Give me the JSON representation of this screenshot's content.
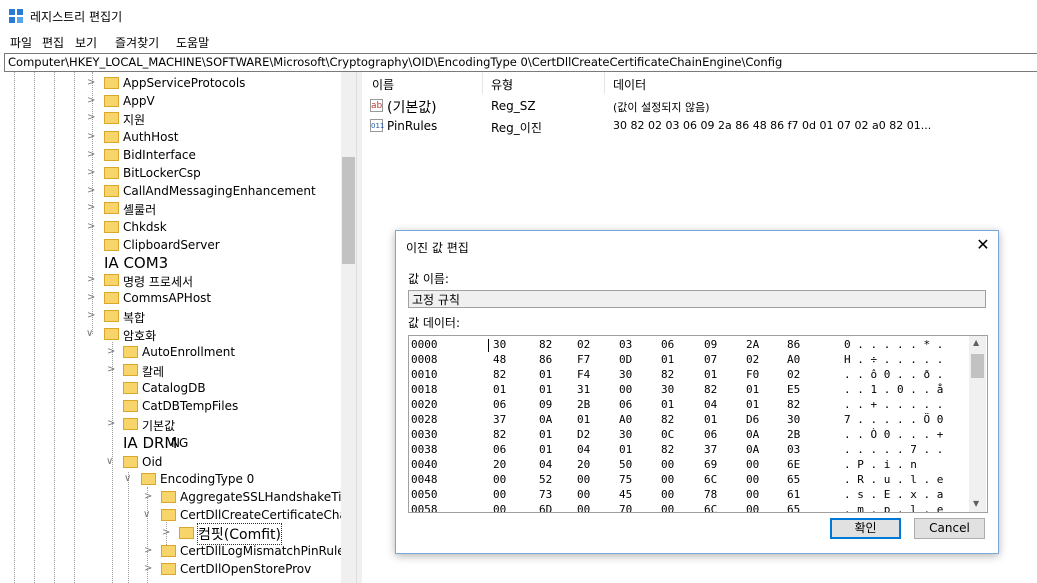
{
  "window": {
    "title": "레지스트리 편집기"
  },
  "menu": [
    "파일",
    "편집",
    "보기",
    "즐겨찾기",
    "도움말"
  ],
  "address": "Computer\\HKEY_LOCAL_MACHINE\\SOFTWARE\\Microsoft\\Cryptography\\OID\\EncodingType 0\\CertDllCreateCertificateChainEngine\\Config",
  "tree": {
    "items": [
      {
        "label": "AppServiceProtocols"
      },
      {
        "label": "AppV"
      },
      {
        "label": "지원"
      },
      {
        "label": "AuthHost"
      },
      {
        "label": "BidInterface"
      },
      {
        "label": "BitLockerCsp"
      },
      {
        "label": "CallAndMessagingEnhancement"
      },
      {
        "label": "셸룰러"
      },
      {
        "label": "Chkdsk"
      },
      {
        "label": "ClipboardServer"
      },
      {
        "label": "IA COM3"
      },
      {
        "label": "명령 프로세서"
      },
      {
        "label": "CommsAPHost"
      },
      {
        "label": "복합"
      },
      {
        "label": "암호화"
      },
      {
        "label": "AutoEnrollment"
      },
      {
        "label": "칼레"
      },
      {
        "label": "CatalogDB"
      },
      {
        "label": "CatDBTempFiles"
      },
      {
        "label": "기본값"
      },
      {
        "label": "IA DRM"
      },
      {
        "label": "Oid"
      },
      {
        "label": "EncodingType 0"
      },
      {
        "label": "AggregateSSLHandshakeTime"
      },
      {
        "label": "CertDllCreateCertificateChainE"
      },
      {
        "label": "컴핏(Comfit)"
      },
      {
        "label": "CertDllLogMismatchPinRules"
      },
      {
        "label": "CertDllOpenStoreProv"
      }
    ],
    "overlap_label": "NG"
  },
  "list": {
    "columns": [
      "이름",
      "유형",
      "데이터"
    ],
    "rows": [
      {
        "icon": "ab",
        "name": "(기본값)",
        "type": "Reg_SZ",
        "data": "(값이 설정되지 않음)"
      },
      {
        "icon": "011",
        "name": "PinRules",
        "type": "Reg_이진",
        "data": "30 82 02 03 06 09 2a 86 48 86 f7 0d 01 07 02 a0 82 01..."
      }
    ]
  },
  "dialog": {
    "title": "이진 값 편집",
    "name_label": "값 이름:",
    "name_value": "고정 규칙",
    "data_label": "값 데이터:",
    "hex_rows": [
      {
        "addr": "0000",
        "bytes": [
          "30",
          "82",
          "02",
          "03",
          "06",
          "09",
          "2A",
          "86"
        ],
        "ascii": "0 . . . . . * ."
      },
      {
        "addr": "0008",
        "bytes": [
          "48",
          "86",
          "F7",
          "0D",
          "01",
          "07",
          "02",
          "A0"
        ],
        "ascii": "H . ÷ . . . . ."
      },
      {
        "addr": "0010",
        "bytes": [
          "82",
          "01",
          "F4",
          "30",
          "82",
          "01",
          "F0",
          "02"
        ],
        "ascii": ". . ô 0 . . ð ."
      },
      {
        "addr": "0018",
        "bytes": [
          "01",
          "01",
          "31",
          "00",
          "30",
          "82",
          "01",
          "E5"
        ],
        "ascii": ". . 1 . 0 . . å"
      },
      {
        "addr": "0020",
        "bytes": [
          "06",
          "09",
          "2B",
          "06",
          "01",
          "04",
          "01",
          "82"
        ],
        "ascii": ". . + . . . . ."
      },
      {
        "addr": "0028",
        "bytes": [
          "37",
          "0A",
          "01",
          "A0",
          "82",
          "01",
          "D6",
          "30"
        ],
        "ascii": "7 . . . . . Ö 0"
      },
      {
        "addr": "0030",
        "bytes": [
          "82",
          "01",
          "D2",
          "30",
          "0C",
          "06",
          "0A",
          "2B"
        ],
        "ascii": ". . Ò 0 . . . +"
      },
      {
        "addr": "0038",
        "bytes": [
          "06",
          "01",
          "04",
          "01",
          "82",
          "37",
          "0A",
          "03"
        ],
        "ascii": ". . . . . 7 . ."
      },
      {
        "addr": "0040",
        "bytes": [
          "20",
          "04",
          "20",
          "50",
          "00",
          "69",
          "00",
          "6E"
        ],
        "ascii": "  .   P . i . n"
      },
      {
        "addr": "0048",
        "bytes": [
          "00",
          "52",
          "00",
          "75",
          "00",
          "6C",
          "00",
          "65"
        ],
        "ascii": ". R . u . l . e"
      },
      {
        "addr": "0050",
        "bytes": [
          "00",
          "73",
          "00",
          "45",
          "00",
          "78",
          "00",
          "61"
        ],
        "ascii": ". s . E . x . a"
      },
      {
        "addr": "0058",
        "bytes": [
          "00",
          "6D",
          "00",
          "70",
          "00",
          "6C",
          "00",
          "65"
        ],
        "ascii": ". m . p . l . e"
      }
    ],
    "ok_label": "확인",
    "cancel_label": "Cancel"
  }
}
